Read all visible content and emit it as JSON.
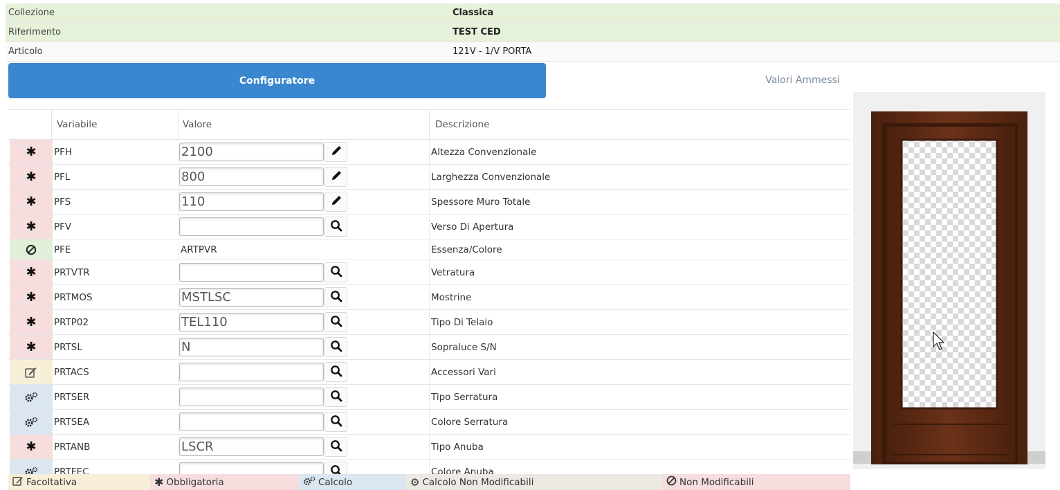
{
  "header": {
    "collezione_label": "Collezione",
    "collezione_value": "Classica",
    "riferimento_label": "Riferimento",
    "riferimento_value": "TEST CED",
    "articolo_label": "Articolo",
    "articolo_value": "121V - 1/V PORTA"
  },
  "tabs": {
    "configuratore": "Configuratore",
    "valori_ammessi": "Valori Ammessi"
  },
  "grid": {
    "columns": {
      "variabile": "Variabile",
      "valore": "Valore",
      "descrizione": "Descrizione"
    },
    "rows": [
      {
        "type": "obbligatoria",
        "icon": "asterisk-icon",
        "variable": "PFH",
        "value": "2100",
        "action": "pencil-icon",
        "description": "Altezza Convenzionale"
      },
      {
        "type": "obbligatoria",
        "icon": "asterisk-icon",
        "variable": "PFL",
        "value": "800",
        "action": "pencil-icon",
        "description": "Larghezza Convenzionale"
      },
      {
        "type": "obbligatoria",
        "icon": "asterisk-icon",
        "variable": "PFS",
        "value": "110",
        "action": "pencil-icon",
        "description": "Spessore Muro Totale"
      },
      {
        "type": "obbligatoria",
        "icon": "asterisk-icon",
        "variable": "PFV",
        "value": "",
        "action": "search-icon",
        "description": "Verso Di Apertura"
      },
      {
        "type": "non-modificabile",
        "icon": "ban-icon",
        "variable": "PFE",
        "value": "ARTPVR",
        "action": "",
        "description": "Essenza/Colore"
      },
      {
        "type": "obbligatoria",
        "icon": "asterisk-icon",
        "variable": "PRTVTR",
        "value": "",
        "action": "search-icon",
        "description": "Vetratura"
      },
      {
        "type": "obbligatoria",
        "icon": "asterisk-icon",
        "variable": "PRTMOS",
        "value": "MSTLSC",
        "action": "search-icon",
        "description": "Mostrine"
      },
      {
        "type": "obbligatoria",
        "icon": "asterisk-icon",
        "variable": "PRTP02",
        "value": "TEL110",
        "action": "search-icon",
        "description": "Tipo Di Telaio"
      },
      {
        "type": "obbligatoria",
        "icon": "asterisk-icon",
        "variable": "PRTSL",
        "value": "N",
        "action": "search-icon",
        "description": "Sopraluce S/N"
      },
      {
        "type": "facoltativa",
        "icon": "edit-icon",
        "variable": "PRTACS",
        "value": "",
        "action": "search-icon",
        "description": "Accessori Vari"
      },
      {
        "type": "calcolo",
        "icon": "cogs-icon",
        "variable": "PRTSER",
        "value": "",
        "action": "search-icon",
        "description": "Tipo Serratura"
      },
      {
        "type": "calcolo",
        "icon": "cogs-icon",
        "variable": "PRTSEA",
        "value": "",
        "action": "search-icon",
        "description": "Colore Serratura"
      },
      {
        "type": "obbligatoria",
        "icon": "asterisk-icon",
        "variable": "PRTANB",
        "value": "LSCR",
        "action": "search-icon",
        "description": "Tipo Anuba"
      },
      {
        "type": "calcolo",
        "icon": "cogs-icon",
        "variable": "PRTFEC",
        "value": "",
        "action": "search-icon",
        "description": "Colore Anuba"
      }
    ]
  },
  "legend": {
    "facoltativa": "Facoltativa",
    "obbligatoria": "Obbligatoria",
    "calcolo": "Calcolo",
    "calcolo_non_modificabili": "Calcolo Non Modificabili",
    "non_modificabili": "Non Modificabili"
  },
  "colors": {
    "accent": "#3a86cf",
    "obbligatoria": "#f6dede",
    "non_modificabile": "#e2efd8",
    "facoltativa": "#f7efd8",
    "calcolo": "#dbe6f0",
    "door_wood": "#5a2a14"
  }
}
